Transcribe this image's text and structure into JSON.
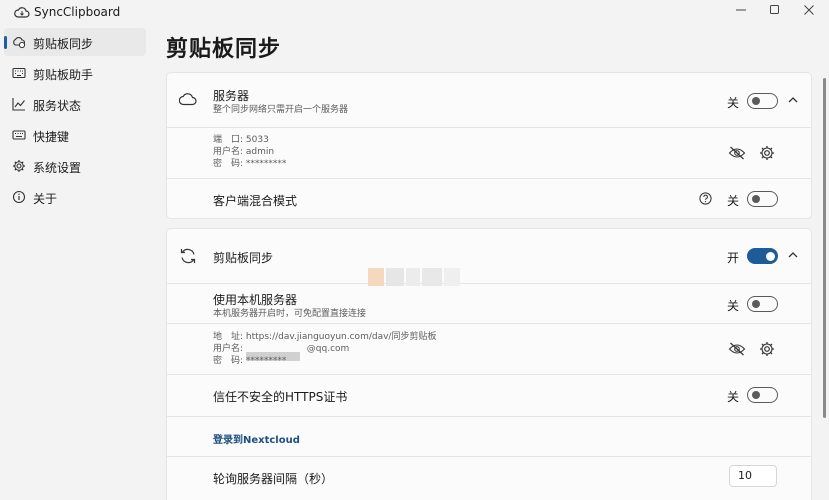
{
  "app": {
    "title": "SyncClipboard"
  },
  "sidebar": {
    "items": [
      {
        "label": "剪贴板同步",
        "icon": "clipboard-sync-icon",
        "active": true
      },
      {
        "label": "剪贴板助手",
        "icon": "keyboard-icon"
      },
      {
        "label": "服务状态",
        "icon": "chart-icon"
      },
      {
        "label": "快捷键",
        "icon": "keyboard-icon"
      },
      {
        "label": "系统设置",
        "icon": "gear-icon"
      },
      {
        "label": "关于",
        "icon": "info-icon"
      }
    ]
  },
  "page": {
    "title": "剪贴板同步"
  },
  "server_card": {
    "title": "服务器",
    "subtitle": "整个同步网络只需开启一个服务器",
    "toggle_label": "关",
    "port_line": "端　口: 5033",
    "user_line": "用户名: admin",
    "password_line": "密　码: *********",
    "mixed_mode_label": "客户端混合模式",
    "mixed_mode_toggle_label": "关"
  },
  "sync_card": {
    "title": "剪贴板同步",
    "toggle_label": "开",
    "local_server_title": "使用本机服务器",
    "local_server_subtitle": "本机服务器开启时，可免配置直接连接",
    "local_server_toggle_label": "关",
    "address_line": "地　址: https://dav.jianguoyun.com/dav/同步剪贴板",
    "user_prefix": "用户名:",
    "user_suffix": "@qq.com",
    "password_line": "密　码: *********",
    "https_title": "信任不安全的HTTPS证书",
    "https_toggle_label": "关",
    "nextcloud_link": "登录到Nextcloud",
    "polling_title": "轮询服务器间隔（秒）",
    "polling_value": "10"
  },
  "colors": {
    "accent": "#1e5c98",
    "background": "#f3f3f3",
    "card": "#fbfbfb"
  }
}
